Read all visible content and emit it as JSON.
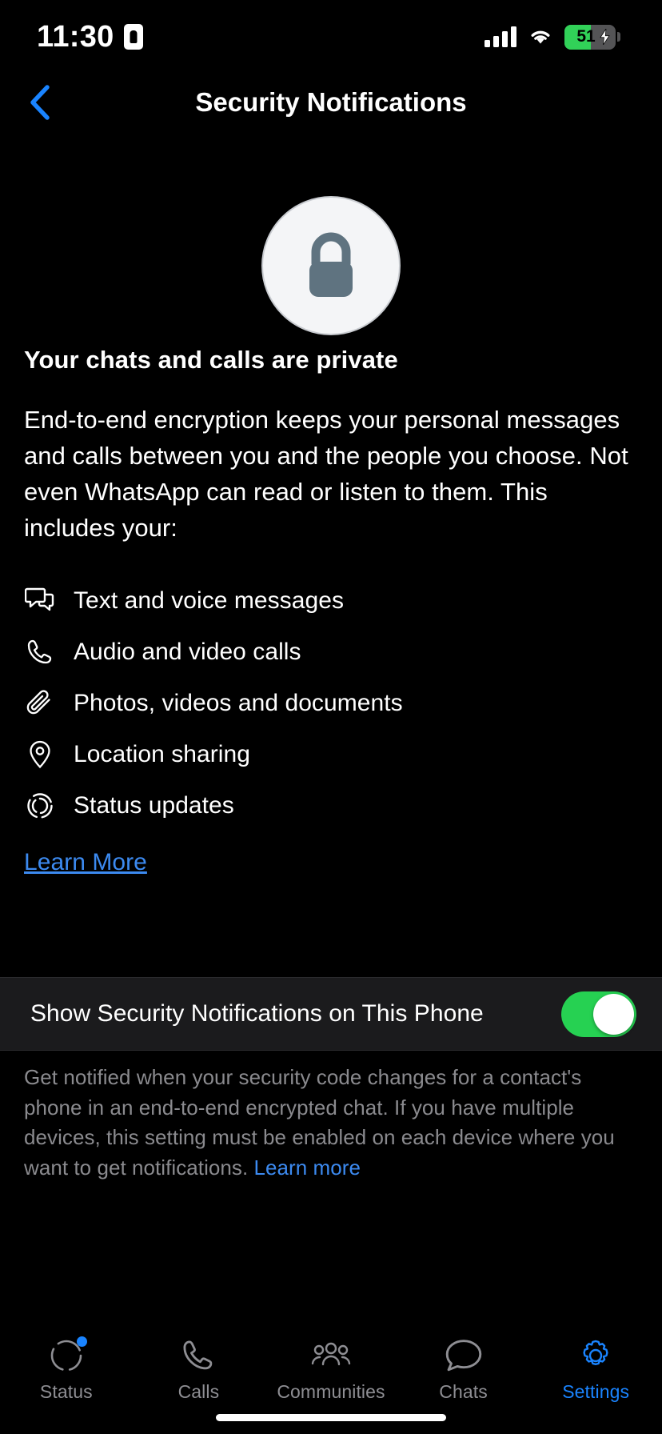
{
  "status_bar": {
    "time": "11:30",
    "left_icon": "id-card-icon",
    "cellular_icon": "cellular-signal-icon",
    "wifi_icon": "wifi-icon",
    "battery_percent": "51",
    "battery_charging": true,
    "battery_fill_color": "#31D158"
  },
  "nav": {
    "back_icon": "chevron-left-icon",
    "title": "Security Notifications",
    "accent_color": "#1A84FF"
  },
  "hero": {
    "icon": "lock-icon",
    "circle_color": "#F4F5F7",
    "lock_color": "#5F7380"
  },
  "main": {
    "headline": "Your chats and calls are private",
    "paragraph": "End-to-end encryption keeps your personal messages and calls between you and the people you choose. Not even WhatsApp can read or listen to them. This includes your:",
    "features": [
      {
        "icon": "chat-bubbles-icon",
        "label": "Text and voice messages"
      },
      {
        "icon": "phone-icon",
        "label": "Audio and video calls"
      },
      {
        "icon": "paperclip-icon",
        "label": "Photos, videos and documents"
      },
      {
        "icon": "location-pin-icon",
        "label": "Location sharing"
      },
      {
        "icon": "status-ring-icon",
        "label": "Status updates"
      }
    ],
    "learn_more": "Learn More",
    "link_color": "#3C8AF0"
  },
  "setting": {
    "label": "Show Security Notifications on This Phone",
    "toggle_on": true,
    "toggle_on_color": "#26D152"
  },
  "footnote": {
    "text": "Get notified when your security code changes for a contact's phone in an end-to-end encrypted chat. If you have multiple devices, this setting must be enabled on each device where you want to get notifications. ",
    "link": "Learn more"
  },
  "tabbar": {
    "items": [
      {
        "icon": "status-ring-icon",
        "label": "Status",
        "active": false,
        "badge": true
      },
      {
        "icon": "phone-icon",
        "label": "Calls",
        "active": false,
        "badge": false
      },
      {
        "icon": "communities-icon",
        "label": "Communities",
        "active": false,
        "badge": false
      },
      {
        "icon": "chats-icon",
        "label": "Chats",
        "active": false,
        "badge": false
      },
      {
        "icon": "gear-icon",
        "label": "Settings",
        "active": true,
        "badge": false
      }
    ],
    "inactive_color": "#8E8E93",
    "active_color": "#1A84FF"
  }
}
